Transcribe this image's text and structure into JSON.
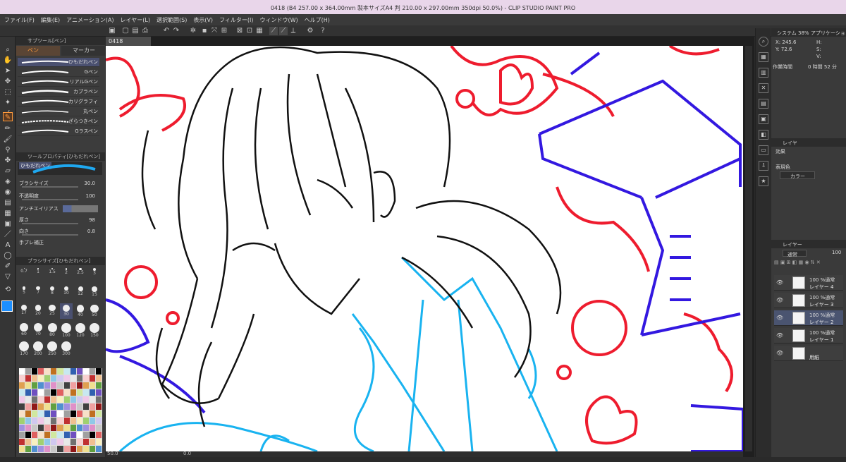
{
  "window": {
    "title": "0418 (B4 257.00 x 364.00mm 製本サイズA4 判 210.00 x 297.00mm 350dpi 50.0%) - CLIP STUDIO PAINT PRO"
  },
  "menu": [
    "ファイル(F)",
    "編集(E)",
    "アニメーション(A)",
    "レイヤー(L)",
    "選択範囲(S)",
    "表示(V)",
    "フィルター(I)",
    "ウィンドウ(W)",
    "ヘルプ(H)"
  ],
  "subtool": {
    "header": "サブツール[ペン]",
    "tabs": [
      "ペン",
      "マーカー"
    ],
    "brushes": [
      "ひもだれペン",
      "Gペン",
      "リアルGペン",
      "カブラペン",
      "カリグラフィ",
      "丸ペン",
      "ざらつきペン",
      "Gラスペン"
    ]
  },
  "toolprop": {
    "header": "ツールプロパティ[ひもだれペン]",
    "name": "ひもだれペン",
    "rows": [
      {
        "label": "ブラシサイズ",
        "value": "30.0"
      },
      {
        "label": "不透明度",
        "value": "100"
      },
      {
        "label": "アンチエイリアス",
        "value": ""
      },
      {
        "label": "厚さ",
        "value": "98"
      },
      {
        "label": "向き",
        "value": "0.8"
      },
      {
        "label": "手ブレ補正",
        "value": ""
      }
    ]
  },
  "brushsize": {
    "header": "ブラシサイズ[ひもだれペン]",
    "sizes": [
      "0.7",
      "1",
      "1.5",
      "2",
      "2.5",
      "3",
      "5",
      "7",
      "8",
      "10",
      "12",
      "15",
      "17",
      "20",
      "25",
      "30",
      "40",
      "50",
      "60",
      "70",
      "80",
      "100",
      "120",
      "150",
      "170",
      "200",
      "250",
      "300"
    ]
  },
  "document": {
    "tab": "0418",
    "zoom": "50.0",
    "angle": "0.0"
  },
  "navigator": {
    "tabs": [
      "システム 38%",
      "アプリケーション"
    ],
    "x": "X: 245.6",
    "y": "Y: 72.6",
    "h": "H:",
    "s": "S:",
    "v": "V:",
    "time_label": "作業時間",
    "time_value": "0 時間 52 分"
  },
  "effect": {
    "tab": "レイヤ",
    "label": "効果",
    "expression_label": "表現色",
    "expression_value": "カラー"
  },
  "layers": {
    "tab": "レイヤー",
    "blend": "通常",
    "opacity": "100",
    "items": [
      {
        "blend": "100 %通常",
        "name": "レイヤー 4",
        "selected": false
      },
      {
        "blend": "100 %通常",
        "name": "レイヤー 3",
        "selected": false
      },
      {
        "blend": "100 %通常",
        "name": "レイヤー 2",
        "selected": true
      },
      {
        "blend": "100 %通常",
        "name": "レイヤー 1",
        "selected": false
      },
      {
        "blend": "",
        "name": "用紙",
        "selected": false
      }
    ]
  },
  "colors": {
    "accent": "#ff9a3c",
    "brush_blue": "#1c8fff",
    "red": "#ee1c2e",
    "blue": "#3318e0",
    "cyan": "#19b3f0"
  }
}
